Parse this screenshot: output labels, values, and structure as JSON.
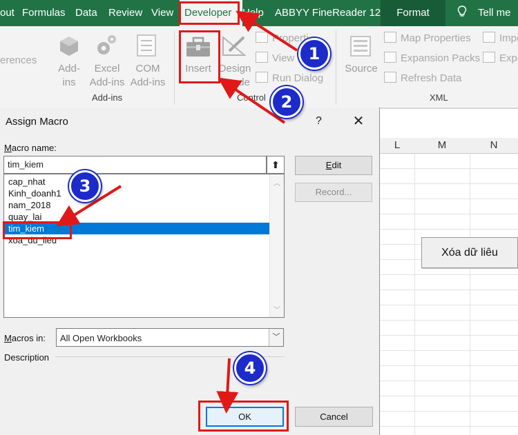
{
  "ribbon_tabs": [
    "out",
    "Formulas",
    "Data",
    "Review",
    "View",
    "Developer",
    "Help",
    "ABBYY FineReader 12",
    "Format",
    "Tell me"
  ],
  "active_tab": "Developer",
  "ribbon": {
    "left_clip": "erences",
    "addins_group": {
      "addins": [
        "Add-",
        "ins"
      ],
      "excel_addins": [
        "Excel",
        "Add-ins"
      ],
      "com_addins": [
        "COM",
        "Add-ins"
      ],
      "label": "Add-ins"
    },
    "controls_group": {
      "insert": "Insert",
      "design_mode": [
        "Design",
        "ode"
      ],
      "properties": "Properti",
      "view_code": "View",
      "run_dialog": "Run Dialog",
      "label": "Control"
    },
    "xml_group": {
      "source": "Source",
      "map_properties": "Map Properties",
      "expansion_packs": "Expansion Packs",
      "refresh_data": "Refresh Data",
      "import": "Impo",
      "export": "Expo",
      "label": "XML"
    }
  },
  "sheet": {
    "columns": [
      "L",
      "M",
      "N"
    ],
    "button_label": "Xóa dữ liêu"
  },
  "dialog": {
    "title": "Assign Macro",
    "help": "?",
    "close": "✕",
    "macro_name_label": "Macro name:",
    "macro_name_value": "tim_kiem",
    "macros": [
      "cap_nhat",
      "Kinh_doanh1",
      "nam_2018",
      "quay_lai",
      "tim_kiem",
      "xoa_du_lieu"
    ],
    "selected_macro": "tim_kiem",
    "edit_button": "Edit",
    "record_button": "Record...",
    "macros_in_label": "Macros in:",
    "macros_in_value": "All Open Workbooks",
    "description_label": "Description",
    "ok_button": "OK",
    "cancel_button": "Cancel"
  },
  "steps": [
    "1",
    "2",
    "3",
    "4"
  ],
  "colors": {
    "ribbon_green": "#217346",
    "format_tab": "#185c37",
    "highlight_red": "#e01818",
    "step_blue": "#1c2bc9",
    "selection_blue": "#0078d7"
  }
}
